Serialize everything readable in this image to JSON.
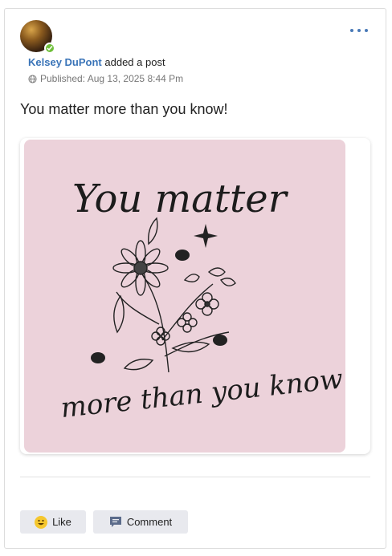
{
  "post": {
    "author_name": "Kelsey DuPont",
    "action_text": "added a post",
    "published_text": "Published: Aug 13, 2025 8:44 Pm",
    "body_text": "You matter more than you know!",
    "image": {
      "line1": "You matter",
      "line2": "more than you know"
    }
  },
  "actions": {
    "like_label": "Like",
    "comment_label": "Comment"
  },
  "colors": {
    "accent": "#3a74b8",
    "image_bg": "#ecd2da",
    "verified_badge": "#6fbf3a",
    "button_bg": "#e8e9ee"
  },
  "icons": {
    "more": "more-dots-icon",
    "globe": "globe-icon",
    "like": "grinning-face-icon",
    "comment": "comment-bubble-icon",
    "verified": "check-badge-icon"
  }
}
